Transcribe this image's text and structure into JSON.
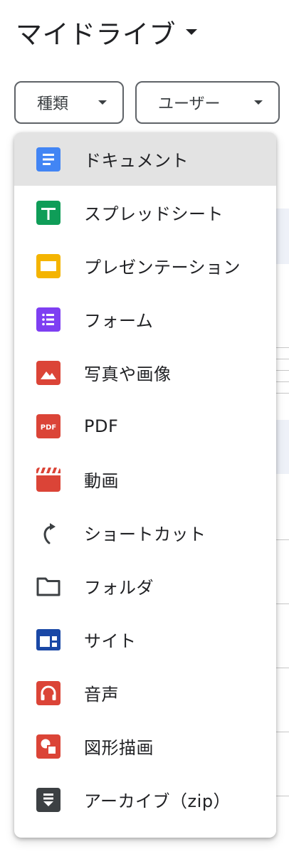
{
  "header": {
    "title": "マイドライブ",
    "caret_icon": "caret-down-icon"
  },
  "filters": {
    "type_label": "種類",
    "user_label": "ユーザー"
  },
  "menu": {
    "items": [
      {
        "label": "ドキュメント",
        "icon": "docs-icon",
        "color": "#4285f4",
        "selected": true
      },
      {
        "label": "スプレッドシート",
        "icon": "sheets-icon",
        "color": "#0f9d58"
      },
      {
        "label": "プレゼンテーション",
        "icon": "slides-icon",
        "color": "#f4b400"
      },
      {
        "label": "フォーム",
        "icon": "forms-icon",
        "color": "#7e3ff2"
      },
      {
        "label": "写真や画像",
        "icon": "image-icon",
        "color": "#db4437"
      },
      {
        "label": "PDF",
        "icon": "pdf-icon",
        "color": "#db4437",
        "icon_text": "PDF"
      },
      {
        "label": "動画",
        "icon": "video-icon",
        "color": "#db4437"
      },
      {
        "label": "ショートカット",
        "icon": "shortcut-icon",
        "color": "#3c4043"
      },
      {
        "label": "フォルダ",
        "icon": "folder-icon",
        "color": "#3c4043"
      },
      {
        "label": "サイト",
        "icon": "sites-icon",
        "color": "#1a48a6"
      },
      {
        "label": "音声",
        "icon": "audio-icon",
        "color": "#db4437"
      },
      {
        "label": "図形描画",
        "icon": "drawings-icon",
        "color": "#db4437"
      },
      {
        "label": "アーカイブ（zip）",
        "icon": "archive-icon",
        "color": "#3c4043"
      }
    ]
  }
}
